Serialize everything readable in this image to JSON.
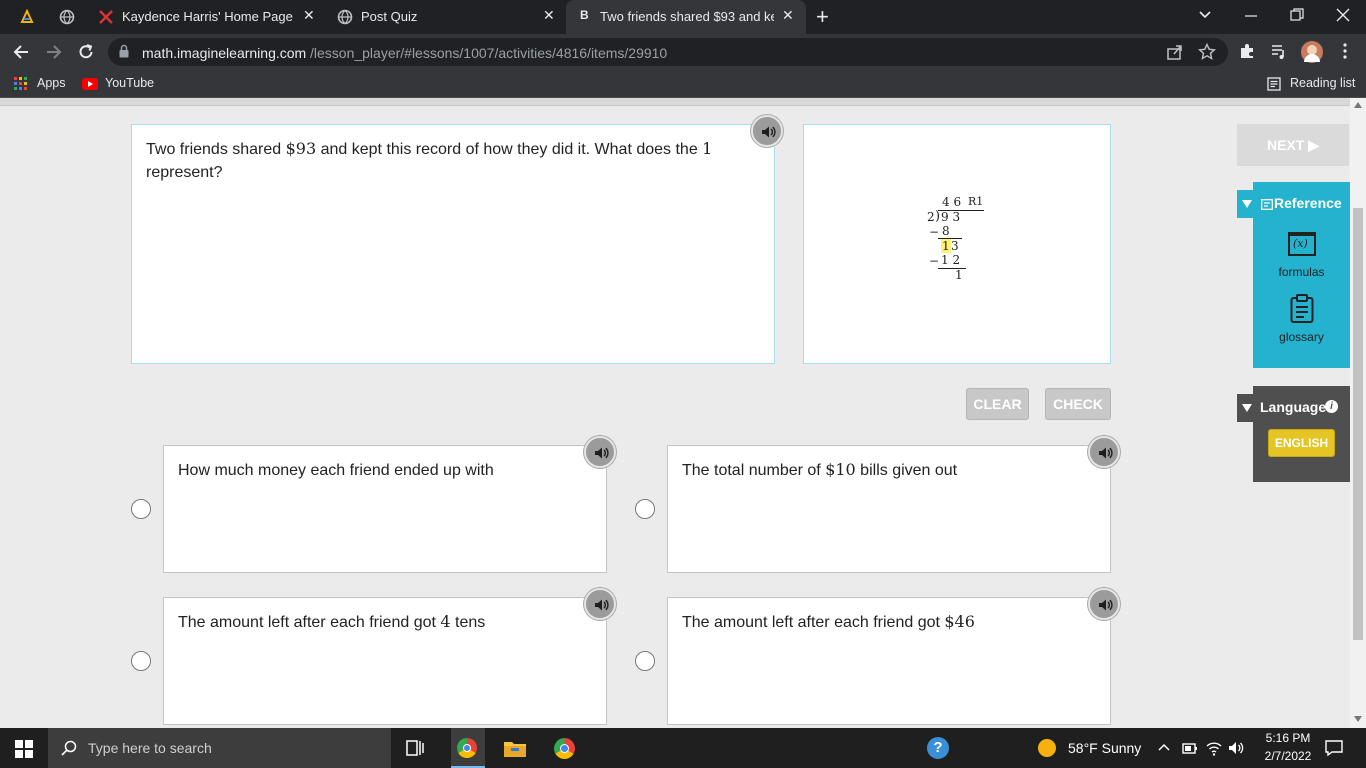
{
  "browser": {
    "tabs": [
      {
        "title": "Kaydence Harris' Home Page",
        "close": "✕"
      },
      {
        "title": "Post Quiz",
        "close": "✕"
      },
      {
        "title": "Two friends shared $93 and kept",
        "close": "✕"
      }
    ],
    "new_tab": "+",
    "url_host": "math.imaginelearning.com",
    "url_path": "/lesson_player/#lessons/1007/activities/4816/items/29910",
    "bookmarks": {
      "apps": "Apps",
      "youtube": "YouTube",
      "reading_list": "Reading list"
    }
  },
  "question": {
    "parts": [
      "Two friends shared ",
      "$93",
      " and kept this record of how they did it. What does the ",
      "1",
      " represent?"
    ]
  },
  "division": {
    "quotient": "4 6",
    "remainder_label": "R1",
    "divisor": "2",
    "dividend": "9 3",
    "step1_minus": "−",
    "step1": "8",
    "step2_hl": "1",
    "step2_rest": "3",
    "step3_minus": "−",
    "step3": "1 2",
    "final": "1"
  },
  "actions": {
    "clear": "CLEAR",
    "check": "CHECK",
    "next": "NEXT ▶"
  },
  "choices": [
    {
      "parts": [
        "How much money each friend ended up with",
        "",
        ""
      ]
    },
    {
      "parts": [
        "The total number of ",
        "$10",
        " bills given out"
      ]
    },
    {
      "parts": [
        "The amount left after each friend got ",
        "4",
        " tens"
      ]
    },
    {
      "parts": [
        "The amount left after each friend got ",
        "$46",
        ""
      ]
    }
  ],
  "reference": {
    "title": "Reference",
    "formulas_icon_text": "(x)",
    "formulas": "formulas",
    "glossary": "glossary"
  },
  "language": {
    "title": "Language",
    "info": "i",
    "english": "ENGLISH"
  },
  "taskbar": {
    "search_placeholder": "Type here to search",
    "weather": "58°F  Sunny",
    "time": "5:16 PM",
    "date": "2/7/2022"
  },
  "colors": {
    "accent": "#24b2cf",
    "english_button": "#e5c526",
    "panel_border": "#a9dde9",
    "highlight": "#fff176"
  }
}
